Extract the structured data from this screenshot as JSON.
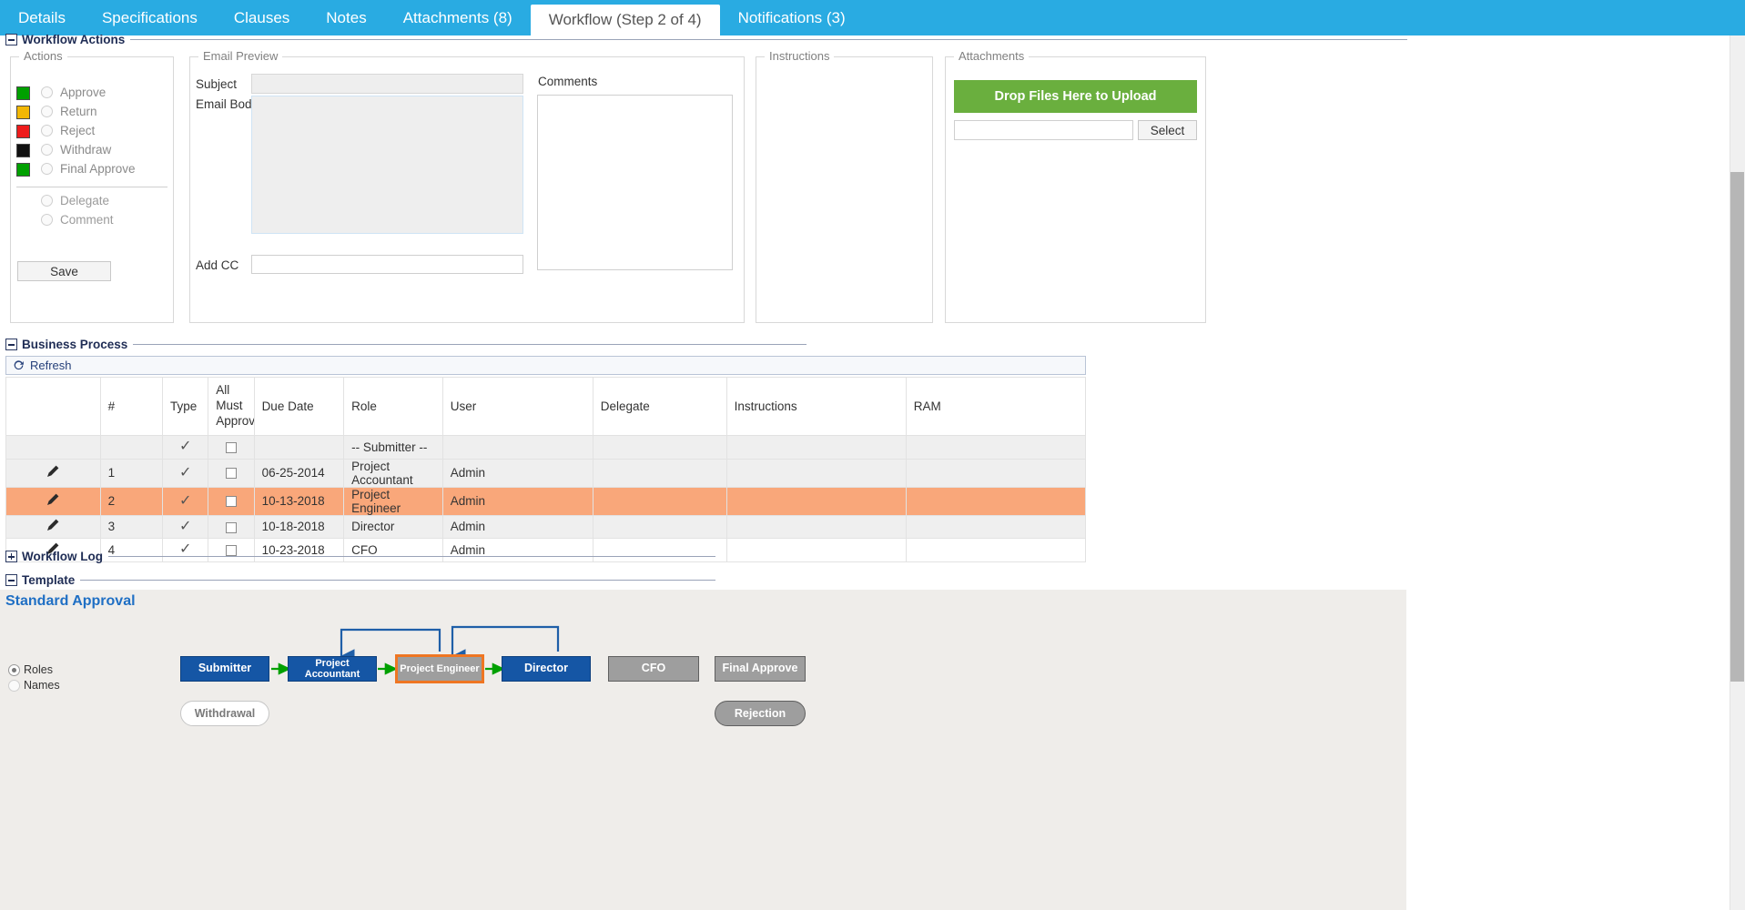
{
  "tabs": [
    {
      "label": "Details",
      "active": false
    },
    {
      "label": "Specifications",
      "active": false
    },
    {
      "label": "Clauses",
      "active": false
    },
    {
      "label": "Notes",
      "active": false
    },
    {
      "label": "Attachments (8)",
      "active": false
    },
    {
      "label": "Workflow (Step 2 of 4)",
      "active": true
    },
    {
      "label": "Notifications (3)",
      "active": false
    }
  ],
  "sections": {
    "workflow_actions": "Workflow Actions",
    "business_process": "Business Process",
    "workflow_log": "Workflow Log",
    "template": "Template"
  },
  "actions_panel": {
    "legend": "Actions",
    "items": [
      {
        "label": "Approve",
        "color": "#00a000",
        "selected": false
      },
      {
        "label": "Return",
        "color": "#f2b705",
        "selected": false
      },
      {
        "label": "Reject",
        "color": "#ee1c1c",
        "selected": false
      },
      {
        "label": "Withdraw",
        "color": "#111111",
        "selected": false
      },
      {
        "label": "Final Approve",
        "color": "#00a000",
        "selected": false
      }
    ],
    "secondary": [
      {
        "label": "Delegate",
        "selected": false
      },
      {
        "label": "Comment",
        "selected": false
      }
    ],
    "save_label": "Save"
  },
  "email_preview": {
    "legend": "Email Preview",
    "subject_label": "Subject",
    "subject_value": "",
    "body_label": "Email Body",
    "body_value": "",
    "addcc_label": "Add CC",
    "addcc_value": ""
  },
  "comments": {
    "label": "Comments",
    "value": ""
  },
  "instructions_panel": {
    "legend": "Instructions",
    "value": ""
  },
  "attachments_panel": {
    "legend": "Attachments",
    "drop_label": "Drop Files Here to Upload",
    "file_value": "",
    "select_label": "Select",
    "drop_color": "#6aaf3e"
  },
  "business_process": {
    "refresh_label": "Refresh",
    "columns": [
      "",
      "#",
      "Type",
      "All Must Approve",
      "Due Date",
      "Role",
      "User",
      "Delegate",
      "Instructions",
      "RAM"
    ],
    "rows": [
      {
        "edit": false,
        "num": "",
        "type": "check",
        "all_must_approve": false,
        "due_date": "",
        "role": "-- Submitter --",
        "user": "",
        "delegate": "",
        "instructions": "",
        "ram": "",
        "style": "alt"
      },
      {
        "edit": true,
        "num": "1",
        "type": "check",
        "all_must_approve": false,
        "due_date": "06-25-2014",
        "role": "Project Accountant",
        "user": "Admin",
        "delegate": "",
        "instructions": "",
        "ram": "",
        "style": "alt"
      },
      {
        "edit": true,
        "num": "2",
        "type": "check",
        "all_must_approve": false,
        "due_date": "10-13-2018",
        "role": "Project Engineer",
        "user": "Admin",
        "delegate": "",
        "instructions": "",
        "ram": "",
        "style": "sel"
      },
      {
        "edit": true,
        "num": "3",
        "type": "check",
        "all_must_approve": false,
        "due_date": "10-18-2018",
        "role": "Director",
        "user": "Admin",
        "delegate": "",
        "instructions": "",
        "ram": "",
        "style": "alt"
      },
      {
        "edit": true,
        "num": "4",
        "type": "check",
        "all_must_approve": false,
        "due_date": "10-23-2018",
        "role": "CFO",
        "user": "Admin",
        "delegate": "",
        "instructions": "",
        "ram": "",
        "style": "plain"
      }
    ],
    "selected_row_color": "#f9a77a"
  },
  "template": {
    "title": "Standard Approval",
    "view_options": [
      {
        "label": "Roles",
        "selected": true
      },
      {
        "label": "Names",
        "selected": false
      }
    ],
    "nodes": [
      {
        "label": "Submitter",
        "state": "done"
      },
      {
        "label": "Project Accountant",
        "state": "done"
      },
      {
        "label": "Project Engineer",
        "state": "current"
      },
      {
        "label": "Director",
        "state": "done"
      },
      {
        "label": "CFO",
        "state": "pending"
      },
      {
        "label": "Final Approve",
        "state": "pending"
      }
    ],
    "withdrawal_label": "Withdrawal",
    "rejection_label": "Rejection",
    "colors": {
      "done": "#1556a5",
      "pending": "#9e9e9e",
      "current_border": "#ef7622",
      "arrow": "#00a000",
      "return_arrow": "#1f5fa8"
    }
  }
}
